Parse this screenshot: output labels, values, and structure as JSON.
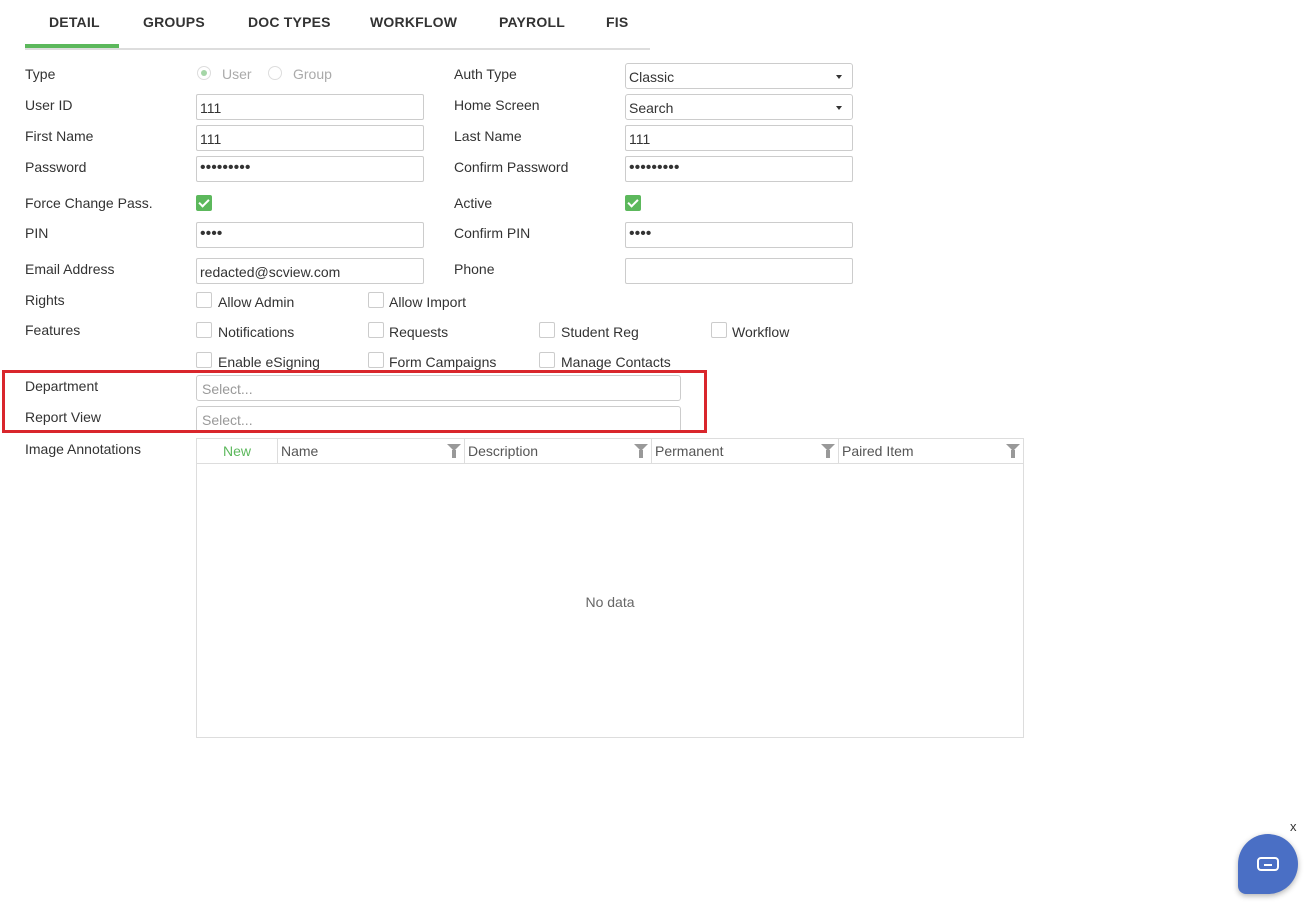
{
  "tabs": [
    {
      "label": "DETAIL",
      "active": true
    },
    {
      "label": "GROUPS"
    },
    {
      "label": "DOC TYPES"
    },
    {
      "label": "WORKFLOW"
    },
    {
      "label": "PAYROLL"
    },
    {
      "label": "FIS"
    }
  ],
  "form": {
    "type_label": "Type",
    "type_options": [
      "User",
      "Group"
    ],
    "type_selected": "User",
    "auth_type_label": "Auth Type",
    "auth_type_value": "Classic",
    "user_id_label": "User ID",
    "user_id_value": "111",
    "home_screen_label": "Home Screen",
    "home_screen_value": "Search",
    "first_name_label": "First Name",
    "first_name_value": "111",
    "last_name_label": "Last Name",
    "last_name_value": "111",
    "password_label": "Password",
    "password_value": "•••••••••",
    "confirm_password_label": "Confirm Password",
    "confirm_password_value": "•••••••••",
    "force_change_label": "Force Change Pass.",
    "force_change_checked": true,
    "active_label": "Active",
    "active_checked": true,
    "pin_label": "PIN",
    "pin_value": "••••",
    "confirm_pin_label": "Confirm PIN",
    "confirm_pin_value": "••••",
    "email_label": "Email Address",
    "email_value": "redacted@scview.com",
    "phone_label": "Phone",
    "phone_value": "",
    "rights_label": "Rights",
    "rights": [
      "Allow Admin",
      "Allow Import"
    ],
    "features_label": "Features",
    "features": [
      "Notifications",
      "Requests",
      "Student Reg",
      "Workflow",
      "Enable eSigning",
      "Form Campaigns",
      "Manage Contacts"
    ],
    "department_label": "Department",
    "department_placeholder": "Select...",
    "report_view_label": "Report View",
    "report_view_placeholder": "Select...",
    "image_annotations_label": "Image Annotations"
  },
  "annotations_grid": {
    "new_label": "New",
    "columns": [
      "Name",
      "Description",
      "Permanent",
      "Paired Item"
    ],
    "empty_text": "No data"
  },
  "chat": {
    "close_label": "x",
    "icon": "chat-icon"
  },
  "colors": {
    "accent": "#5cb85c",
    "highlight": "#d9262c",
    "chat": "#4a6fc5"
  }
}
